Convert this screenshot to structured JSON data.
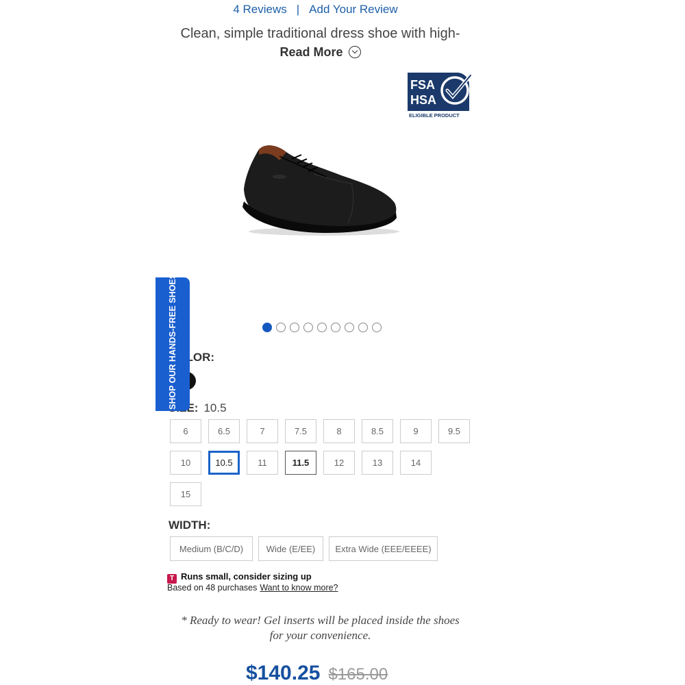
{
  "reviews": {
    "count_label": "4 Reviews",
    "separator": "|",
    "add_label": "Add Your Review"
  },
  "description": {
    "text": "Clean, simple traditional dress shoe with high-",
    "read_more": "Read More"
  },
  "badge": {
    "line1": "FSA",
    "line2": "HSA",
    "caption": "ELIGIBLE PRODUCT"
  },
  "gallery": {
    "total_dots": 9,
    "active_index": 0
  },
  "color": {
    "label": "COLOR:",
    "swatch_color": "#111111"
  },
  "size": {
    "label": "SIZE:",
    "selected": "10.5",
    "options": [
      "6",
      "6.5",
      "7",
      "7.5",
      "8",
      "8.5",
      "9",
      "9.5",
      "10",
      "10.5",
      "11",
      "11.5",
      "12",
      "13",
      "14",
      "15"
    ]
  },
  "width": {
    "label": "WIDTH:",
    "options": [
      "Medium (B/C/D)",
      "Wide (E/EE)",
      "Extra Wide (EEE/EEEE)"
    ]
  },
  "fit": {
    "icon": "T",
    "title": "Runs small, consider sizing up",
    "basis": "Based on 48 purchases",
    "link": "Want to know more?"
  },
  "note": {
    "line1": "* Ready to wear! Gel inserts will be placed inside the shoes",
    "line2": "for your convenience."
  },
  "price": {
    "current": "$140.25",
    "original": "$165.00"
  },
  "side_tab": {
    "label": "SHOP OUR HANDS-FREE SHOES"
  },
  "colors": {
    "accent": "#1a5fd0",
    "price": "#1650a0",
    "link": "#1d5fa8",
    "badge_navy": "#1b3a6b",
    "fit_icon": "#c8174b"
  }
}
